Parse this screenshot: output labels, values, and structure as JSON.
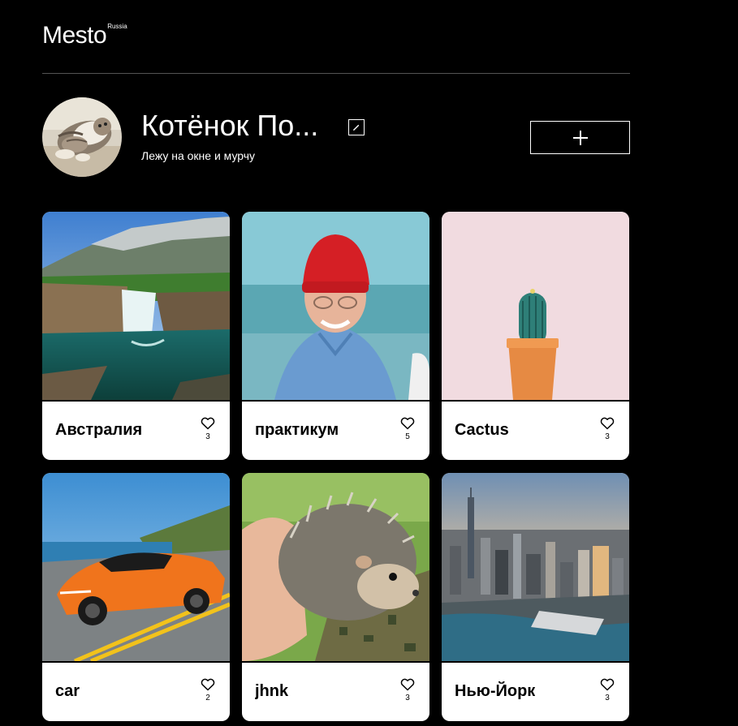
{
  "header": {
    "logo": "Mesto",
    "logo_sup": "Russia"
  },
  "profile": {
    "name": "Котёнок По...",
    "about": "Лежу на окне и мурчу"
  },
  "cards": [
    {
      "title": "Австралия",
      "likes": "3"
    },
    {
      "title": "практикум",
      "likes": "5"
    },
    {
      "title": "Cactus",
      "likes": "3"
    },
    {
      "title": "car",
      "likes": "2"
    },
    {
      "title": "jhnk",
      "likes": "3"
    },
    {
      "title": "Нью-Йорк",
      "likes": "3"
    }
  ],
  "icons": {
    "edit": "pencil-icon",
    "add": "plus-icon",
    "like": "heart-icon"
  },
  "colors": {
    "background": "#000000",
    "card": "#ffffff",
    "divider": "#545454"
  }
}
